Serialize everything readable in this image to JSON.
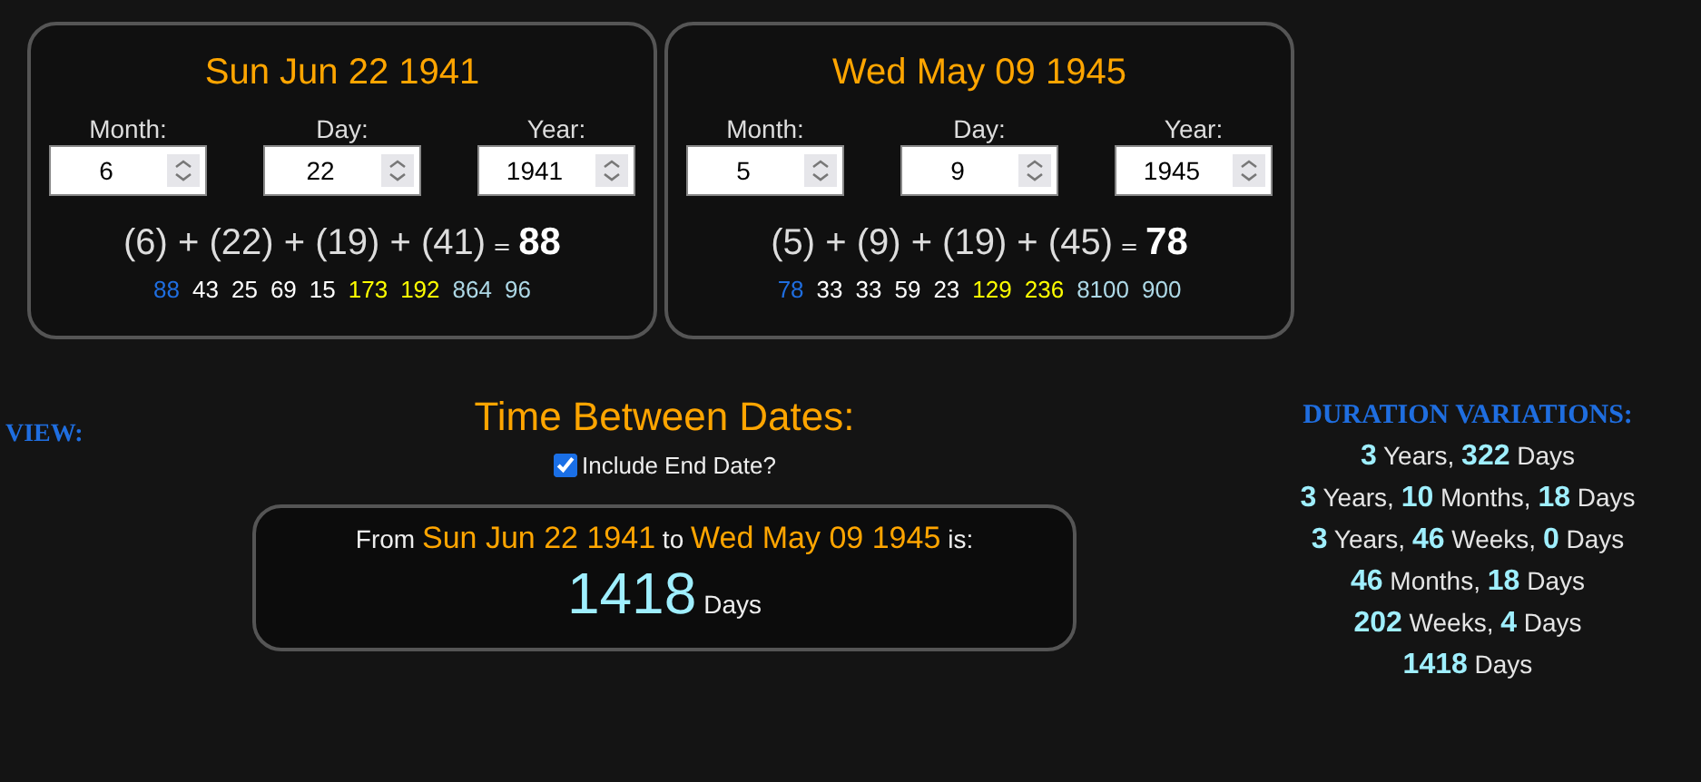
{
  "dates": [
    {
      "title": "Sun Jun 22 1941",
      "fields": [
        {
          "label": "Month:",
          "value": "6"
        },
        {
          "label": "Day:",
          "value": "22"
        },
        {
          "label": "Year:",
          "value": "1941"
        }
      ],
      "equation": "(6) + (22) + (19) + (41)",
      "equals": "=",
      "total": "88",
      "numbers": [
        {
          "text": "88",
          "color": "#1f6ee0"
        },
        {
          "text": "43",
          "color": "#ffffff"
        },
        {
          "text": "25",
          "color": "#ffffff"
        },
        {
          "text": "69",
          "color": "#ffffff"
        },
        {
          "text": "15",
          "color": "#ffffff"
        },
        {
          "text": "173",
          "color": "#ffff00"
        },
        {
          "text": "192",
          "color": "#ffff00"
        },
        {
          "text": "864",
          "color": "#add8e6"
        },
        {
          "text": "96",
          "color": "#add8e6"
        }
      ]
    },
    {
      "title": "Wed May 09 1945",
      "fields": [
        {
          "label": "Month:",
          "value": "5"
        },
        {
          "label": "Day:",
          "value": "9"
        },
        {
          "label": "Year:",
          "value": "1945"
        }
      ],
      "equation": "(5) + (9) + (19) + (45)",
      "equals": "=",
      "total": "78",
      "numbers": [
        {
          "text": "78",
          "color": "#1f6ee0"
        },
        {
          "text": "33",
          "color": "#ffffff"
        },
        {
          "text": "33",
          "color": "#ffffff"
        },
        {
          "text": "59",
          "color": "#ffffff"
        },
        {
          "text": "23",
          "color": "#ffffff"
        },
        {
          "text": "129",
          "color": "#ffff00"
        },
        {
          "text": "236",
          "color": "#ffff00"
        },
        {
          "text": "8100",
          "color": "#add8e6"
        },
        {
          "text": "900",
          "color": "#add8e6"
        }
      ]
    }
  ],
  "view_label": "VIEW:",
  "between": {
    "title": "Time Between Dates:",
    "include_end": {
      "label": "Include End Date?",
      "checked": true
    },
    "sentence": "From **Sun Jun 22 1941** to **Wed May 09 1945** is:",
    "count": "1418",
    "unit": "Days"
  },
  "durations": {
    "title": "DURATION VARIATIONS:",
    "lines": [
      "**3** Years, **322** Days",
      "**3** Years, **10** Months, **18** Days",
      "**3** Years, **46** Weeks, **0** Days",
      "**46** Months, **18** Days",
      "**202** Weeks, **4** Days",
      "**1418** Days"
    ]
  }
}
